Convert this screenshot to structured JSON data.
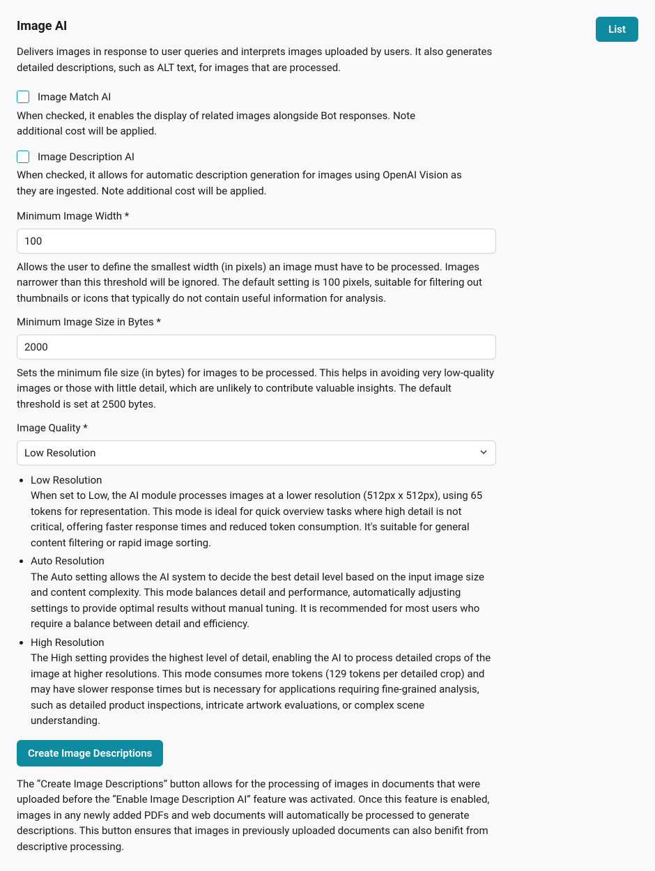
{
  "header": {
    "title": "Image AI",
    "intro": "Delivers images in response to user queries and interprets images uploaded by users. It also generates detailed descriptions, such as ALT text, for images that are processed.",
    "list_button": "List"
  },
  "checkboxes": {
    "match": {
      "label": "Image Match AI",
      "hint": "When checked, it enables the display of related images alongside Bot responses. Note additional cost will be applied."
    },
    "description": {
      "label": "Image Description AI",
      "hint": "When checked, it allows for automatic description generation for images using OpenAI Vision as they are ingested. Note additional cost will be applied."
    }
  },
  "fields": {
    "min_width": {
      "label": "Minimum Image Width *",
      "value": "100",
      "hint": "Allows the user to define the smallest width (in pixels) an image must have to be processed. Images narrower than this threshold will be ignored. The default setting is 100 pixels, suitable for filtering out thumbnails or icons that typically do not contain useful information for analysis."
    },
    "min_size": {
      "label": "Minimum Image Size in Bytes *",
      "value": "2000",
      "hint": "Sets the minimum file size (in bytes) for images to be processed. This helps in avoiding very low-quality images or those with little detail, which are unlikely to contribute valuable insights. The default threshold is set at 2500 bytes."
    },
    "quality": {
      "label": "Image Quality *",
      "selected": "Low Resolution",
      "options": [
        {
          "title": "Low Resolution",
          "desc": "When set to Low, the AI module processes images at a lower resolution (512px x 512px), using 65 tokens for representation. This mode is ideal for quick overview tasks where high detail is not critical, offering faster response times and reduced token consumption. It's suitable for general content filtering or rapid image sorting."
        },
        {
          "title": "Auto Resolution",
          "desc": "The Auto setting allows the AI system to decide the best detail level based on the input image size and content complexity. This mode balances detail and performance, automatically adjusting settings to provide optimal results without manual tuning. It is recommended for most users who require a balance between detail and efficiency."
        },
        {
          "title": "High Resolution",
          "desc": "The High setting provides the highest level of detail, enabling the AI to process detailed crops of the image at higher resolutions. This mode consumes more tokens (129 tokens per detailed crop) and may have slower response times but is necessary for applications requiring fine-grained analysis, such as detailed product inspections, intricate artwork evaluations, or complex scene understanding."
        }
      ]
    }
  },
  "actions": {
    "create": {
      "label": "Create Image Descriptions",
      "hint": "The “Create Image Descriptions” button allows for the processing of images in documents that were uploaded before the “Enable Image Description AI” feature was activated. Once this feature is enabled, images in any newly added PDFs and web documents will automatically be processed to generate descriptions. This button ensures that images in previously uploaded documents can also benifit from descriptive processing."
    }
  }
}
